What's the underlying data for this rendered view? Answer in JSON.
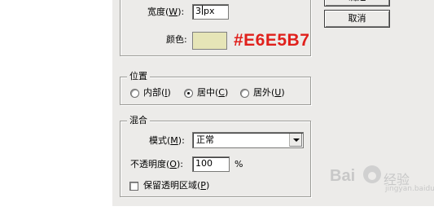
{
  "stroke": {
    "width_label": "宽度(",
    "width_mnemonic": "W",
    "width_label_end": "):",
    "width_value": "3",
    "width_unit": "px",
    "color_label": "颜色:",
    "color_hex_annotation": "#E6E5B7",
    "color_value": "#E6E5B7"
  },
  "position": {
    "legend": "位置",
    "options": [
      {
        "label": "内部(",
        "mnemonic": "I",
        "end": ")",
        "selected": false
      },
      {
        "label": "居中(",
        "mnemonic": "C",
        "end": ")",
        "selected": true
      },
      {
        "label": "居外(",
        "mnemonic": "U",
        "end": ")",
        "selected": false
      }
    ]
  },
  "blending": {
    "legend": "混合",
    "mode_label": "模式(",
    "mode_mnemonic": "M",
    "mode_label_end": "):",
    "mode_value": "正常",
    "opacity_label": "不透明度(",
    "opacity_mnemonic": "O",
    "opacity_label_end": "):",
    "opacity_value": "100",
    "opacity_unit": "%",
    "preserve_label": "保留透明区域(",
    "preserve_mnemonic": "P",
    "preserve_label_end": ")",
    "preserve_checked": false
  },
  "buttons": {
    "ok_label": "确定",
    "cancel_label": "取消"
  },
  "watermark": {
    "brand": "Bai",
    "brand_end": "经验",
    "sub": "jingyan.baidu.com"
  },
  "colors": {
    "dialog_bg": "#ECEBE9",
    "annotation": "#E0201C",
    "swatch": "#E6E5B7"
  }
}
